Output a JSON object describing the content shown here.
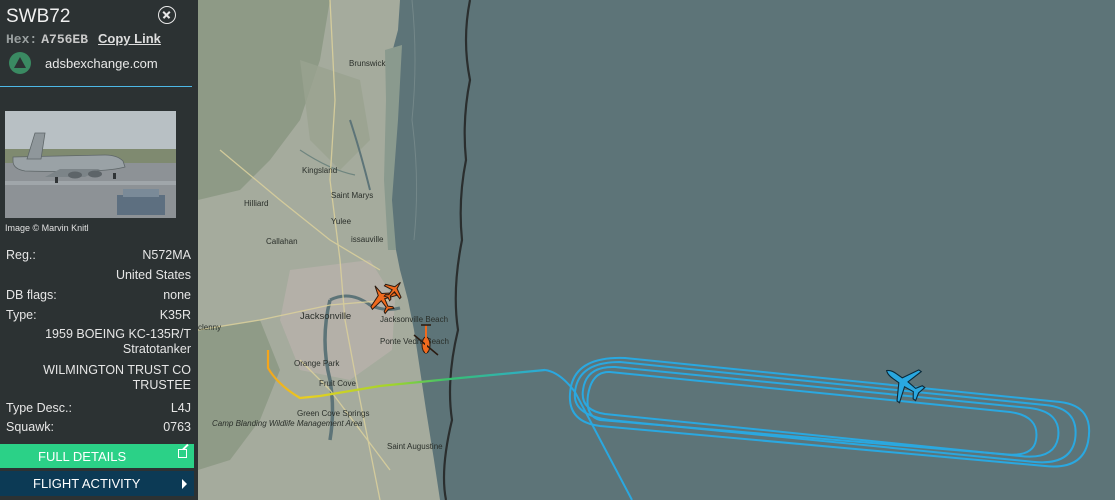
{
  "panel": {
    "callsign": "SWB72",
    "hex_label": "Hex:",
    "hex_value": "A756EB",
    "copy_link": "Copy Link",
    "source": "adsbexchange.com",
    "image_credit": "Image © Marvin Knitl",
    "reg_label": "Reg.:",
    "reg_value": "N572MA",
    "country": "United States",
    "dbflags_label": "DB flags:",
    "dbflags_value": "none",
    "type_label": "Type:",
    "type_value": "K35R",
    "aircraft_line1": "1959 BOEING KC-135R/T",
    "aircraft_line2": "Stratotanker",
    "owner_line1": "WILMINGTON TRUST CO",
    "owner_line2": "TRUSTEE",
    "typedesc_label": "Type Desc.:",
    "typedesc_value": "L4J",
    "squawk_label": "Squawk:",
    "squawk_value": "0763",
    "full_details": "FULL DETAILS",
    "flight_activity": "FLIGHT ACTIVITY"
  },
  "map": {
    "places": {
      "brunswick": "Brunswick",
      "kingsland": "Kingsland",
      "saint_marys": "Saint Marys",
      "hilliard": "Hilliard",
      "yulee": "Yulee",
      "callahan": "Callahan",
      "issauville": "issauville",
      "jacksonville": "Jacksonville",
      "jacksonville_beach": "Jacksonville Beach",
      "ponte_vedra": "Ponte Vedra Beach",
      "clenny": "clenny",
      "orange_park": "Orange Park",
      "fruit_cove": "Fruit Cove",
      "green_cove": "Green Cove Springs",
      "camp_blanding": "Camp Blanding Wildlife Management Area",
      "saint_augustine": "Saint Augustine"
    },
    "track_color": "#2aa8e0",
    "selected_aircraft_color": "#2aa8e0",
    "other_aircraft_color": "#f06a1e",
    "water_color": "#5d7478"
  }
}
